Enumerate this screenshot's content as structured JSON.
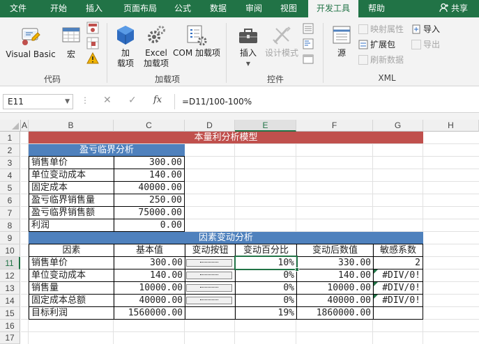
{
  "tabs": [
    "文件",
    "开始",
    "插入",
    "页面布局",
    "公式",
    "数据",
    "审阅",
    "视图",
    "开发工具",
    "帮助"
  ],
  "active_tab": "开发工具",
  "share_label": "共享",
  "ribbon": {
    "code_group": {
      "label": "代码",
      "visual_basic": "Visual Basic",
      "macro": "宏"
    },
    "addins_group": {
      "label": "加载项",
      "addins": "加\n载项",
      "excel_addins": "Excel\n加载项",
      "com_addins": "COM 加载项"
    },
    "controls_group": {
      "label": "控件",
      "insert": "插入",
      "design_mode": "设计模式"
    },
    "xml_group": {
      "label": "XML",
      "source": "源",
      "map_properties": "映射属性",
      "expansion_packs": "扩展包",
      "refresh_data": "刷新数据",
      "import": "导入",
      "export": "导出"
    }
  },
  "formula_bar": {
    "name_box": "E11",
    "formula": "=D11/100-100%"
  },
  "columns": [
    "A",
    "B",
    "C",
    "D",
    "E",
    "F",
    "G",
    "H"
  ],
  "rows": [
    "1",
    "2",
    "3",
    "4",
    "5",
    "6",
    "7",
    "8",
    "9",
    "10",
    "11",
    "12",
    "13",
    "14",
    "15",
    "16",
    "17"
  ],
  "sheet": {
    "title": "本量利分析模型",
    "breakeven_header": "盈亏临界分析",
    "breakeven": [
      {
        "label": "销售单价",
        "value": "300.00"
      },
      {
        "label": "单位变动成本",
        "value": "140.00"
      },
      {
        "label": "固定成本",
        "value": "40000.00"
      },
      {
        "label": "盈亏临界销售量",
        "value": "250.00"
      },
      {
        "label": "盈亏临界销售额",
        "value": "75000.00"
      },
      {
        "label": "利润",
        "value": "0.00"
      }
    ],
    "factor_header": "因素变动分析",
    "factor_cols": [
      "因素",
      "基本值",
      "变动按钮",
      "变动百分比",
      "变动后数值",
      "敏感系数"
    ],
    "factor_rows": [
      {
        "factor": "销售单价",
        "base": "300.00",
        "pct": "10%",
        "after": "330.00",
        "sens": "2"
      },
      {
        "factor": "单位变动成本",
        "base": "140.00",
        "pct": "0%",
        "after": "140.00",
        "sens": "#DIV/0!"
      },
      {
        "factor": "销售量",
        "base": "10000.00",
        "pct": "0%",
        "after": "10000.00",
        "sens": "#DIV/0!"
      },
      {
        "factor": "固定成本总额",
        "base": "40000.00",
        "pct": "0%",
        "after": "40000.00",
        "sens": "#DIV/0!"
      },
      {
        "factor": "目标利润",
        "base": "1560000.00",
        "pct": "19%",
        "after": "1860000.00",
        "sens": ""
      }
    ]
  },
  "colors": {
    "accent": "#217346",
    "title_band": "#c0504d",
    "section_band": "#4f81bd"
  }
}
